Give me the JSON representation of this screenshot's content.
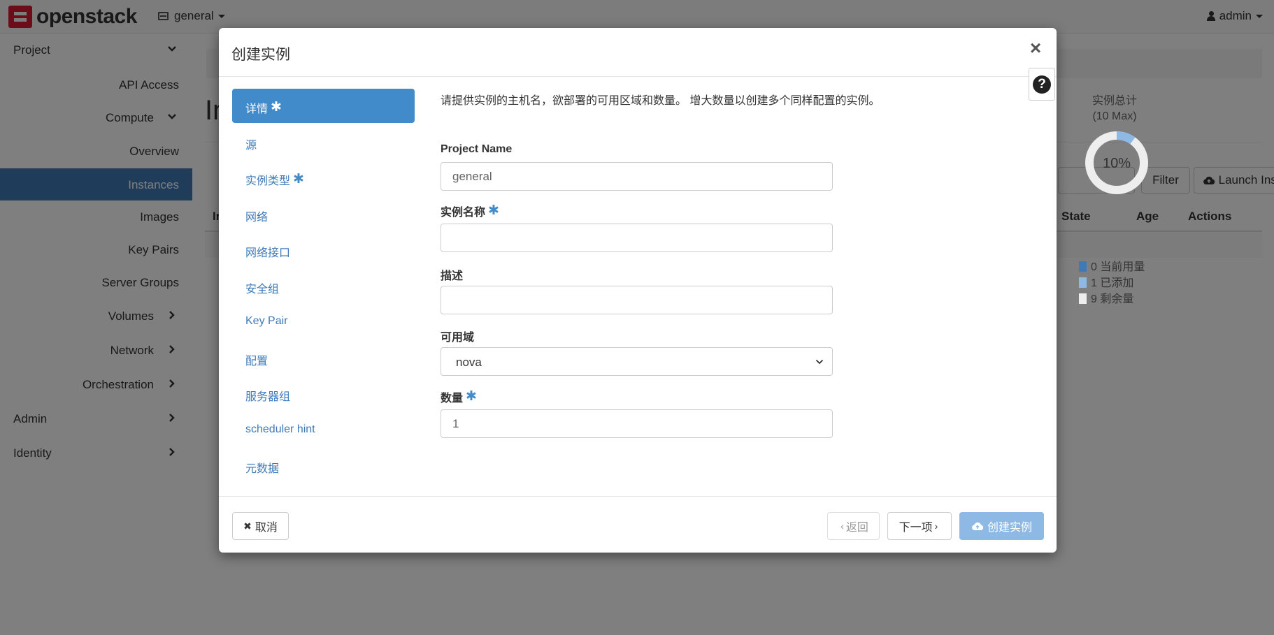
{
  "navbar": {
    "brand": "openstack",
    "project": "general",
    "user": "admin"
  },
  "sidebar": {
    "items": [
      {
        "label": "Project",
        "level": 0,
        "chevron": "down"
      },
      {
        "label": "API Access",
        "level": 2
      },
      {
        "label": "Compute",
        "level": 1,
        "chevron": "down"
      },
      {
        "label": "Overview",
        "level": 2
      },
      {
        "label": "Instances",
        "level": 2,
        "active": true
      },
      {
        "label": "Images",
        "level": 2
      },
      {
        "label": "Key Pairs",
        "level": 2
      },
      {
        "label": "Server Groups",
        "level": 2
      },
      {
        "label": "Volumes",
        "level": 1,
        "chevron": "right"
      },
      {
        "label": "Network",
        "level": 1,
        "chevron": "right"
      },
      {
        "label": "Orchestration",
        "level": 1,
        "chevron": "right"
      },
      {
        "label": "Admin",
        "level": 0,
        "chevron": "right"
      },
      {
        "label": "Identity",
        "level": 0,
        "chevron": "right"
      }
    ]
  },
  "background": {
    "page_title": "In",
    "filter_label": "Filter",
    "launch_label": "Launch Instance",
    "table_headers": [
      "In",
      "State",
      "Age",
      "Actions"
    ]
  },
  "modal": {
    "title": "创建实例",
    "close_glyph": "×",
    "help_glyph": "?",
    "nav": [
      {
        "label": "详情",
        "required": true,
        "active": true
      },
      {
        "label": "源",
        "required": false
      },
      {
        "label": "实例类型",
        "required": true
      },
      {
        "label": "网络",
        "required": false
      },
      {
        "label": "网络接口",
        "required": false
      },
      {
        "label": "安全组",
        "required": false
      },
      {
        "label": "Key Pair",
        "required": false
      },
      {
        "label": "配置",
        "required": false
      },
      {
        "label": "服务器组",
        "required": false
      },
      {
        "label": "scheduler hint",
        "required": false
      },
      {
        "label": "元数据",
        "required": false
      }
    ],
    "required_mark": "✱",
    "intro": "请提供实例的主机名，欲部署的可用区域和数量。 增大数量以创建多个同样配置的实例。",
    "fields": {
      "project_name": {
        "label": "Project Name",
        "value": "general"
      },
      "instance_name": {
        "label": "实例名称",
        "value": "",
        "required": true
      },
      "description": {
        "label": "描述",
        "value": ""
      },
      "availability_zone": {
        "label": "可用域",
        "value": "nova"
      },
      "count": {
        "label": "数量",
        "value": "1",
        "required": true
      }
    },
    "quota": {
      "title_line1": "实例总计",
      "title_line2": "(10 Max)",
      "percent_label": "10%",
      "max": 10,
      "used": 0,
      "added": 1,
      "remaining": 9,
      "legend": [
        {
          "count": "0",
          "label": "当前用量",
          "color": "#3f7ab7"
        },
        {
          "count": "1",
          "label": "已添加",
          "color": "#8db9e4"
        },
        {
          "count": "9",
          "label": "剩余量",
          "color": "#eeeeee"
        }
      ]
    },
    "footer": {
      "cancel": "取消",
      "back": "返回",
      "next": "下一项",
      "create": "创建实例"
    }
  },
  "colors": {
    "accent": "#428bca",
    "sidebar_active": "#3f7ab7",
    "create_disabled": "#8db9e4",
    "brand_red": "#da1a32"
  }
}
